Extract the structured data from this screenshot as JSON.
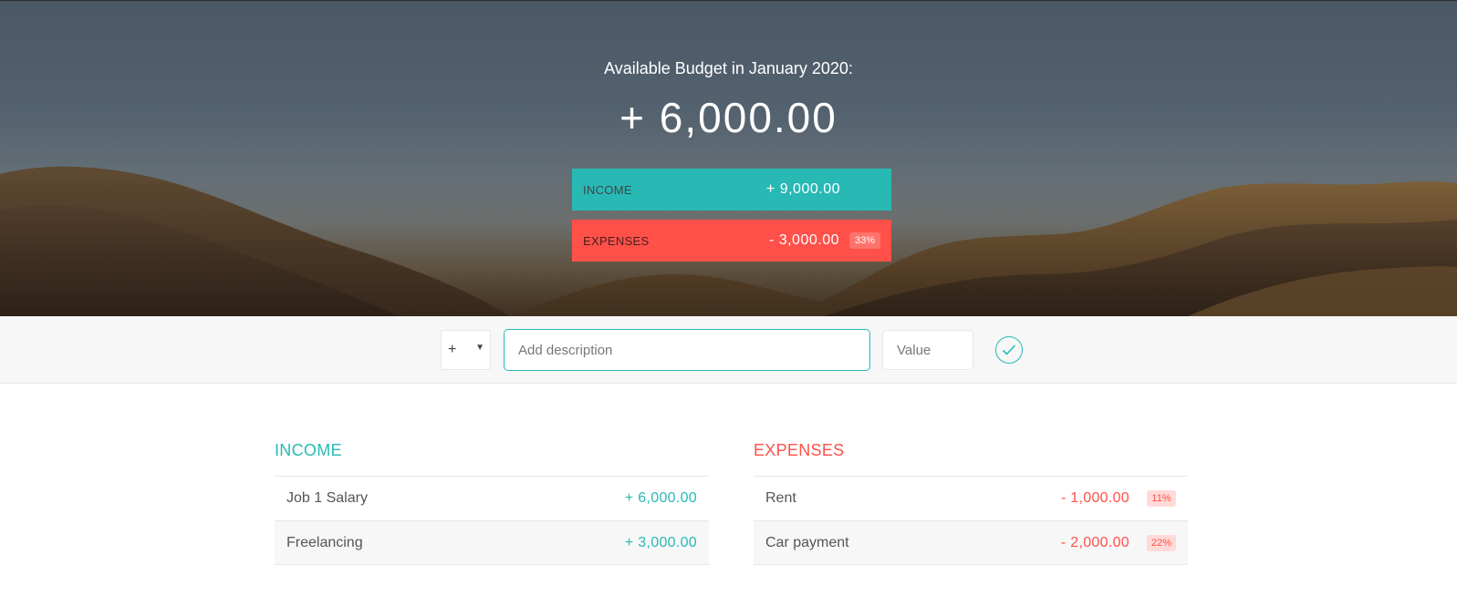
{
  "header": {
    "title": "Available Budget in January 2020:",
    "budget_value": "+ 6,000.00"
  },
  "summary": {
    "income_label": "Income",
    "income_value": "+ 9,000.00",
    "expenses_label": "Expenses",
    "expenses_value": "- 3,000.00",
    "expenses_percentage": "33%"
  },
  "add_form": {
    "type_value": "+",
    "description_placeholder": "Add description",
    "description_value": "",
    "value_placeholder": "Value",
    "value_value": "",
    "submit_icon": "checkmark-circle-icon"
  },
  "income": {
    "title": "Income",
    "items": [
      {
        "description": "Job 1 Salary",
        "value": "+ 6,000.00"
      },
      {
        "description": "Freelancing",
        "value": "+ 3,000.00"
      }
    ]
  },
  "expenses": {
    "title": "Expenses",
    "items": [
      {
        "description": "Rent",
        "value": "- 1,000.00",
        "percentage": "11%"
      },
      {
        "description": "Car payment",
        "value": "- 2,000.00",
        "percentage": "22%"
      }
    ]
  },
  "colors": {
    "income_accent": "#28b9b5",
    "expense_accent": "#ff5049"
  }
}
